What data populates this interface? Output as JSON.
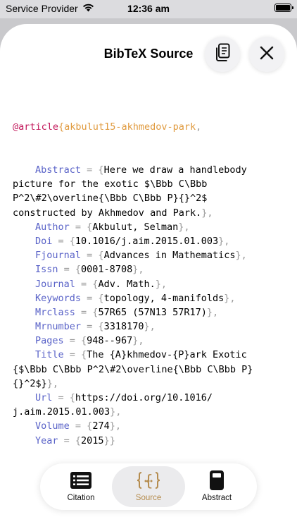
{
  "status": {
    "carrier": "Service Provider",
    "time": "12:36 am"
  },
  "sheet": {
    "title": "BibTeX Source"
  },
  "bibtex": {
    "type": "@article",
    "open": "{",
    "key": "akbulut15-akhmedov-park",
    "key_comma": ",",
    "lines": [
      [
        [
          "field",
          "Abstract"
        ],
        [
          "punct",
          " = "
        ],
        [
          "punct",
          "{"
        ],
        [
          "text",
          "Here we draw a handlebody"
        ]
      ],
      [
        [
          "text",
          "picture for the exotic $\\Bbb C\\Bbb"
        ]
      ],
      [
        [
          "text",
          "P^2\\#2\\overline{\\Bbb C\\Bbb P}{}^2$"
        ]
      ],
      [
        [
          "text",
          "constructed by Akhmedov and Park."
        ],
        [
          "punct",
          "},"
        ]
      ],
      [
        [
          "field",
          "Author"
        ],
        [
          "punct",
          " = "
        ],
        [
          "punct",
          "{"
        ],
        [
          "text",
          "Akbulut, Selman"
        ],
        [
          "punct",
          "},"
        ]
      ],
      [
        [
          "field",
          "Doi"
        ],
        [
          "punct",
          " = "
        ],
        [
          "punct",
          "{"
        ],
        [
          "text",
          "10.1016/j.aim.2015.01.003"
        ],
        [
          "punct",
          "},"
        ]
      ],
      [
        [
          "field",
          "Fjournal"
        ],
        [
          "punct",
          " = "
        ],
        [
          "punct",
          "{"
        ],
        [
          "text",
          "Advances in Mathematics"
        ],
        [
          "punct",
          "},"
        ]
      ],
      [
        [
          "field",
          "Issn"
        ],
        [
          "punct",
          " = "
        ],
        [
          "punct",
          "{"
        ],
        [
          "text",
          "0001-8708"
        ],
        [
          "punct",
          "},"
        ]
      ],
      [
        [
          "field",
          "Journal"
        ],
        [
          "punct",
          " = "
        ],
        [
          "punct",
          "{"
        ],
        [
          "text",
          "Adv. Math."
        ],
        [
          "punct",
          "},"
        ]
      ],
      [
        [
          "field",
          "Keywords"
        ],
        [
          "punct",
          " = "
        ],
        [
          "punct",
          "{"
        ],
        [
          "text",
          "topology, 4-manifolds"
        ],
        [
          "punct",
          "},"
        ]
      ],
      [
        [
          "field",
          "Mrclass"
        ],
        [
          "punct",
          " = "
        ],
        [
          "punct",
          "{"
        ],
        [
          "text",
          "57R65 (57N13 57R17)"
        ],
        [
          "punct",
          "},"
        ]
      ],
      [
        [
          "field",
          "Mrnumber"
        ],
        [
          "punct",
          " = "
        ],
        [
          "punct",
          "{"
        ],
        [
          "text",
          "3318170"
        ],
        [
          "punct",
          "},"
        ]
      ],
      [
        [
          "field",
          "Pages"
        ],
        [
          "punct",
          " = "
        ],
        [
          "punct",
          "{"
        ],
        [
          "text",
          "948--967"
        ],
        [
          "punct",
          "},"
        ]
      ],
      [
        [
          "field",
          "Title"
        ],
        [
          "punct",
          " = "
        ],
        [
          "punct",
          "{"
        ],
        [
          "text",
          "The {A}khmedov-{P}ark Exotic"
        ]
      ],
      [
        [
          "text",
          "{$\\Bbb C\\Bbb P^2\\#2\\overline{\\Bbb C\\Bbb P}"
        ]
      ],
      [
        [
          "text",
          "{}^2$}"
        ],
        [
          "punct",
          "},"
        ]
      ],
      [
        [
          "field",
          "Url"
        ],
        [
          "punct",
          " = "
        ],
        [
          "punct",
          "{"
        ],
        [
          "text",
          "https://doi.org/10.1016/"
        ]
      ],
      [
        [
          "text",
          "j.aim.2015.01.003"
        ],
        [
          "punct",
          "},"
        ]
      ],
      [
        [
          "field",
          "Volume"
        ],
        [
          "punct",
          " = "
        ],
        [
          "punct",
          "{"
        ],
        [
          "text",
          "274"
        ],
        [
          "punct",
          "},"
        ]
      ],
      [
        [
          "field",
          "Year"
        ],
        [
          "punct",
          " = "
        ],
        [
          "punct",
          "{"
        ],
        [
          "text",
          "2015"
        ],
        [
          "punct",
          "}}"
        ]
      ]
    ],
    "indented": [
      true,
      false,
      false,
      false,
      true,
      true,
      true,
      true,
      true,
      true,
      true,
      true,
      true,
      true,
      false,
      false,
      true,
      false,
      true,
      true
    ]
  },
  "tabs": [
    {
      "label": "Citation",
      "icon": "list-icon",
      "selected": false
    },
    {
      "label": "Source",
      "icon": "braces-icon",
      "selected": true
    },
    {
      "label": "Abstract",
      "icon": "document-icon",
      "selected": false
    }
  ],
  "colors": {
    "accent": "#b58c4e",
    "keyword": "#c2185b",
    "field": "#5a63c8",
    "bib_key": "#e09a3e"
  }
}
